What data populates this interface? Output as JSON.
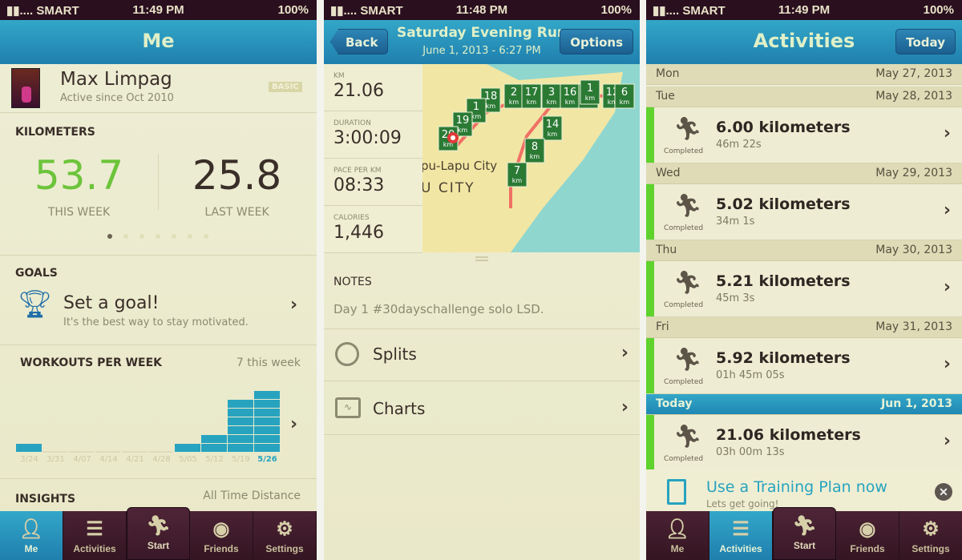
{
  "panels": {
    "me": {
      "status": {
        "carrier": "▮▮.... SMART",
        "time": "11:49 PM",
        "battery": "100%"
      },
      "title": "Me",
      "profile": {
        "name": "Max Limpag",
        "since": "Active since Oct 2010",
        "badge": "BASIC"
      },
      "kilometers": {
        "header": "KILOMETERS",
        "this_week": "53.7",
        "this_week_label": "THIS WEEK",
        "last_week": "25.8",
        "last_week_label": "LAST WEEK",
        "page_count": 7,
        "page_active": 0
      },
      "goals": {
        "header": "GOALS",
        "title": "Set a goal!",
        "subtitle": "It's the best way to stay motivated."
      },
      "workouts": {
        "header": "WORKOUTS PER WEEK",
        "summary": "7 this week"
      },
      "insights": {
        "header": "INSIGHTS",
        "selector": "All Time Distance"
      }
    },
    "run": {
      "status": {
        "carrier": "▮▮.... SMART",
        "time": "11:48 PM",
        "battery": "100%"
      },
      "back": "Back",
      "title": "Saturday Evening Run",
      "subtitle": "June 1, 2013 - 6:27 PM",
      "options": "Options",
      "stats": [
        {
          "label": "KM",
          "value": "21.06"
        },
        {
          "label": "DURATION",
          "value": "3:00:09"
        },
        {
          "label": "PACE PER KM",
          "value": "08:33"
        },
        {
          "label": "CALORIES",
          "value": "1,446"
        }
      ],
      "map": {
        "labels": [
          "pu-Lapu City",
          "U CITY"
        ],
        "markers": [
          "18",
          "2",
          "17",
          "3",
          "16",
          "0",
          "12",
          "1",
          "1",
          "19",
          "20",
          "14",
          "8",
          "7",
          "6"
        ],
        "marker_unit": "km"
      },
      "notes": {
        "header": "NOTES",
        "text": "Day 1 #30dayschallenge solo LSD."
      },
      "menu": [
        {
          "label": "Splits",
          "icon": "stopwatch-icon"
        },
        {
          "label": "Charts",
          "icon": "chart-icon"
        }
      ]
    },
    "activities": {
      "status": {
        "carrier": "▮▮.... SMART",
        "time": "11:49 PM",
        "battery": "100%"
      },
      "title": "Activities",
      "today_button": "Today",
      "days": [
        {
          "day": "Mon",
          "date": "May 27, 2013"
        },
        {
          "day": "Tue",
          "date": "May 28, 2013",
          "km": "6.00 kilometers",
          "duration": "46m 22s",
          "status": "Completed"
        },
        {
          "day": "Wed",
          "date": "May 29, 2013",
          "km": "5.02 kilometers",
          "duration": "34m 1s",
          "status": "Completed"
        },
        {
          "day": "Thu",
          "date": "May 30, 2013",
          "km": "5.21 kilometers",
          "duration": "45m 3s",
          "status": "Completed"
        },
        {
          "day": "Fri",
          "date": "May 31, 2013",
          "km": "5.92 kilometers",
          "duration": "01h 45m 05s",
          "status": "Completed"
        },
        {
          "day": "Today",
          "date": "Jun 1, 2013",
          "km": "21.06 kilometers",
          "duration": "03h 00m 13s",
          "status": "Completed"
        }
      ],
      "promo": {
        "title": "Use a Training Plan now",
        "subtitle": "Lets get going!"
      }
    }
  },
  "tabs": [
    {
      "label": "Me",
      "icon": "person-icon"
    },
    {
      "label": "Activities",
      "icon": "list-icon"
    },
    {
      "label": "Start",
      "icon": "runner-icon"
    },
    {
      "label": "Friends",
      "icon": "friends-icon"
    },
    {
      "label": "Settings",
      "icon": "gears-icon"
    }
  ],
  "colors": {
    "accent": "#27a3bf",
    "green": "#6cc43a",
    "statusbar": "#2a0f1e",
    "tabbar": "#3e1a2a"
  },
  "chart_data": {
    "type": "bar",
    "title": "WORKOUTS PER WEEK",
    "categories": [
      "3/24",
      "3/31",
      "4/07",
      "4/14",
      "4/21",
      "4/28",
      "5/05",
      "5/12",
      "5/19",
      "5/26"
    ],
    "values": [
      1,
      0,
      0,
      0,
      0,
      0,
      1,
      2,
      6,
      7
    ],
    "highlight": "5/26"
  }
}
